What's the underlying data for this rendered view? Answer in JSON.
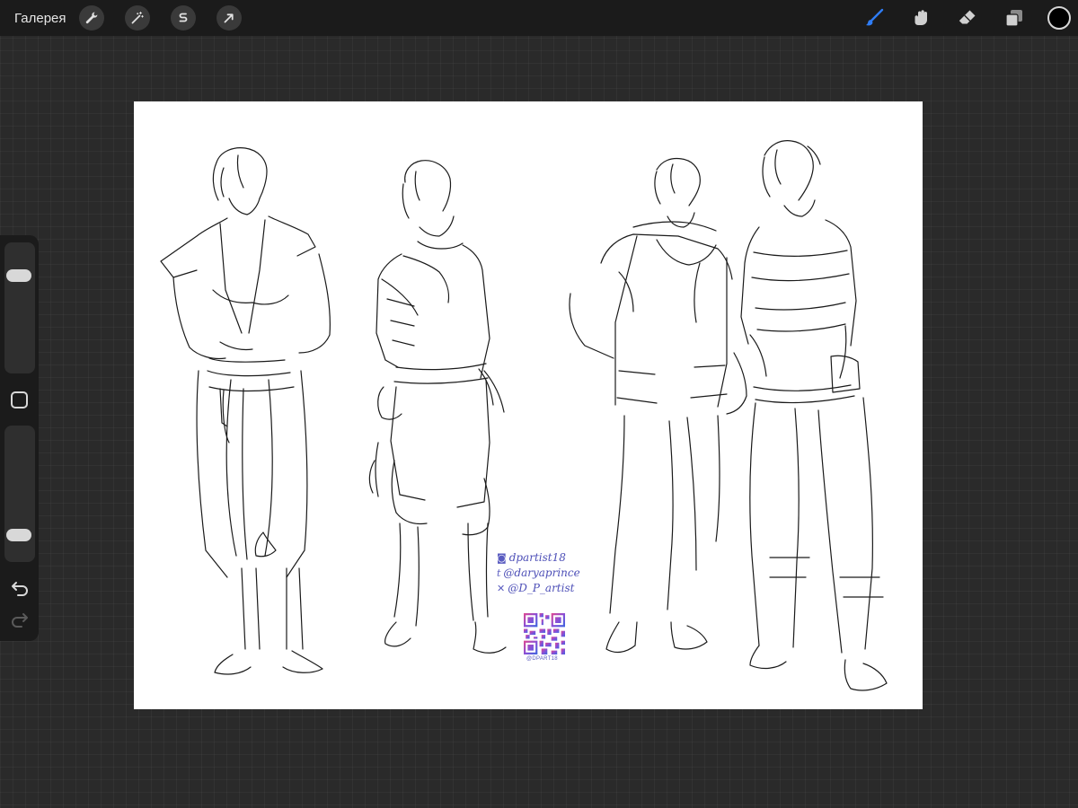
{
  "topbar": {
    "gallery_label": "Галерея",
    "left_tools": [
      {
        "name": "actions",
        "icon": "wrench-icon"
      },
      {
        "name": "adjustments",
        "icon": "magic-wand-icon"
      },
      {
        "name": "selection",
        "icon": "selection-s-icon"
      },
      {
        "name": "transform",
        "icon": "arrow-cursor-icon"
      }
    ],
    "right_tools": [
      {
        "name": "brush",
        "icon": "brush-icon",
        "active": true
      },
      {
        "name": "smudge",
        "icon": "smudge-icon",
        "active": false
      },
      {
        "name": "eraser",
        "icon": "eraser-icon",
        "active": false
      },
      {
        "name": "layers",
        "icon": "layers-icon",
        "active": false
      }
    ],
    "current_color": "#000000"
  },
  "sidebar": {
    "brush_size_level": 0.79,
    "opacity_level": 0.15,
    "modify_icon": "square-icon",
    "undo_icon": "undo-icon",
    "redo_icon": "redo-icon"
  },
  "canvas": {
    "credits": {
      "instagram": "dpartist18",
      "telegram": "@daryaprince",
      "x_handle": "@D_P_artist",
      "qr_caption": "@DPART18"
    }
  },
  "colors": {
    "accent": "#2f7df6",
    "toolbar_bg": "#1b1b1b",
    "workspace_bg": "#2a2a2a",
    "credit_text": "#4d4fb7"
  }
}
